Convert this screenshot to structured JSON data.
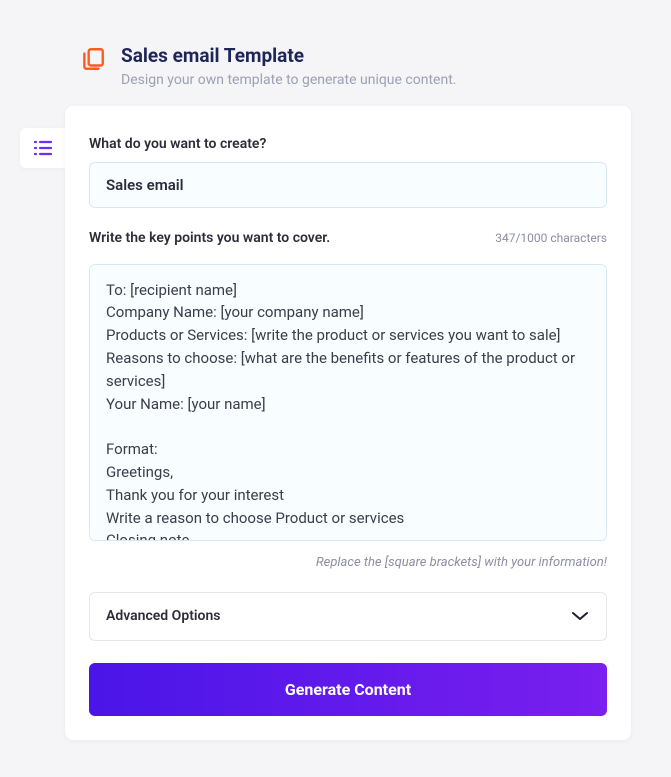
{
  "header": {
    "title": "Sales email Template",
    "subtitle": "Design your own template to generate unique content."
  },
  "form": {
    "create_label": "What do you want to create?",
    "create_value": "Sales email",
    "keypoints_label": "Write the key points you want to cover.",
    "char_count": "347/1000 characters",
    "keypoints_value": "To: [recipient name]\nCompany Name: [your company name]\nProducts or Services: [write the product or services you want to sale]\nReasons to choose: [what are the benefits or features of the product or services]\nYour Name: [your name]\n\nFormat:\nGreetings,\nThank you for your interest\nWrite a reason to choose Product or services\nClosing note",
    "hint": "Replace the [square brackets] with your information!",
    "advanced_label": "Advanced Options",
    "generate_label": "Generate Content"
  }
}
